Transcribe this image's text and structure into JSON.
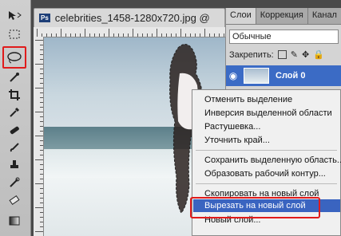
{
  "tools": [
    {
      "name": "move-tool-icon"
    },
    {
      "name": "marquee-tool-icon"
    },
    {
      "name": "lasso-tool-icon",
      "highlighted": true
    },
    {
      "name": "magic-wand-tool-icon"
    },
    {
      "name": "crop-tool-icon"
    },
    {
      "name": "eyedropper-tool-icon"
    },
    {
      "name": "healing-brush-tool-icon"
    },
    {
      "name": "brush-tool-icon"
    },
    {
      "name": "clone-stamp-tool-icon"
    },
    {
      "name": "history-brush-tool-icon"
    },
    {
      "name": "eraser-tool-icon"
    },
    {
      "name": "gradient-tool-icon"
    }
  ],
  "document": {
    "badge": "Ps",
    "title": "celebrities_1458-1280x720.jpg @"
  },
  "panels": {
    "tabs": [
      "Слои",
      "Коррекция",
      "Канал"
    ],
    "blend_mode": "Обычные",
    "lock_label": "Закрепить:",
    "layer_name": "Слой 0"
  },
  "context_menu": {
    "items": [
      "Отменить выделение",
      "Инверсия выделенной области",
      "Растушевка...",
      "Уточнить край...",
      "Сохранить выделенную область...",
      "Образовать рабочий контур...",
      "Скопировать на новый слой",
      "Вырезать на новый слой",
      "Новый слой..."
    ],
    "highlighted_item": "Вырезать на новый слой"
  },
  "colors": {
    "highlight": "#3a64c0",
    "annotation_red": "#e01b1b"
  }
}
